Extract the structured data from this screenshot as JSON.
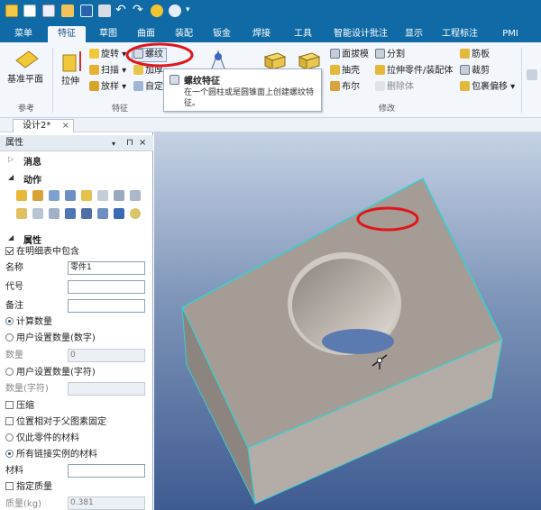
{
  "tabs": [
    "菜单",
    "特征",
    "草图",
    "曲面",
    "装配",
    "钣金",
    "焊接",
    "工具",
    "智能设计批注",
    "显示",
    "工程标注",
    "PMI"
  ],
  "active_tab": "特征",
  "ribbon": {
    "ref_plane": "基准平面",
    "ref_group": "参考",
    "extrude": "拉伸",
    "revolve": "旋转",
    "sweep": "扫描",
    "loft": "放样",
    "thread": "螺纹",
    "add_material": "加厚",
    "custom": "自定",
    "feature_group": "特征",
    "face_draft": "面拔模",
    "shell": "抽壳",
    "boolean": "布尔",
    "split": "分割",
    "pull_assembly": "拉伸零件/装配体",
    "delete_body": "删除体",
    "rib": "筋板",
    "trim": "裁剪",
    "wrap_offset": "包裹偏移",
    "modify_group": "修改"
  },
  "tooltip": {
    "title": "螺纹特征",
    "body": "在一个圆柱或是圆锥面上创建螺纹特征。"
  },
  "doc_tab": "设计2*",
  "panel": {
    "title": "属性",
    "sec_message": "消息",
    "sec_action": "动作",
    "sec_props": "属性",
    "include_bom": "在明细表中包含",
    "name_label": "名称",
    "name_value": "零件1",
    "code_label": "代号",
    "note_label": "备注",
    "calc_qty": "计算数量",
    "user_qty_num": "用户设置数量(数字)",
    "qty_label": "数量",
    "qty_value": "0",
    "user_qty_str": "用户设置数量(字符)",
    "qty_str_label": "数量(字符)",
    "compress": "压缩",
    "fix_pos": "位置相对于父图素固定",
    "this_part_mat": "仅此零件的材料",
    "all_link_mat": "所有链接实例的材料",
    "material_label": "材料",
    "spec_mass": "指定质量",
    "mass_label": "质量(kg)",
    "mass_value": "0.381"
  },
  "colors": {
    "title_bar": "#0f6aa5",
    "highlight_ellipse": "#e0161b",
    "part_face": "#a59c95",
    "edge_highlight": "#37d0d0"
  }
}
